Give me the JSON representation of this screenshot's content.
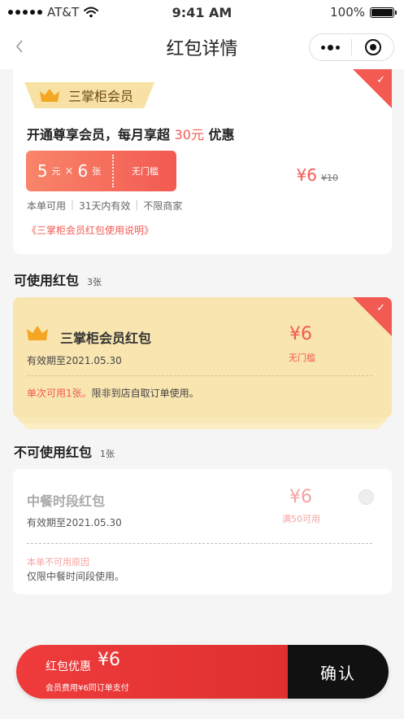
{
  "status_bar": {
    "carrier": "AT&T",
    "time": "9:41 AM",
    "battery": "100%"
  },
  "nav": {
    "title": "红包详情",
    "icons": [
      "back-arrow-icon",
      "more-icon",
      "close-ring-icon"
    ]
  },
  "member": {
    "tag": "三掌柜会员",
    "headline_prefix": "开通尊享会员，每月享超",
    "headline_amount": "30元",
    "headline_suffix": "优惠",
    "ticket": {
      "amount": "5",
      "amount_unit": "元",
      "times": "×",
      "count": "6",
      "count_unit": "张",
      "threshold": "无门槛"
    },
    "price": "¥6",
    "original_price": "¥10",
    "features": [
      "本单可用",
      "31天内有效",
      "不限商家"
    ],
    "link": "《三掌柜会员红包使用说明》",
    "selected": true
  },
  "usable": {
    "section_title": "可使用红包",
    "count": "3张",
    "coupon": {
      "name": "三掌柜会员红包",
      "expiry": "有效期至2021.05.30",
      "value": "¥6",
      "condition": "无门槛",
      "rule_highlight": "单次可用1张。",
      "rule_text": "限非到店自取订单使用。",
      "selected": true
    }
  },
  "unusable": {
    "section_title": "不可使用红包",
    "count": "1张",
    "coupon": {
      "name": "中餐时段红包",
      "expiry": "有效期至2021.05.30",
      "value": "¥6",
      "condition": "满50可用",
      "reason_title": "本单不可用原因",
      "reason": "仅限中餐时间段使用。"
    }
  },
  "bottom_bar": {
    "label": "红包优惠",
    "amount": "¥6",
    "sub": "会员费用¥6同订单支付",
    "confirm": "确认"
  },
  "colors": {
    "accent": "#f25a52",
    "gold": "#f8e5b0",
    "crown": "#f5a623",
    "confirm_bg": "#111111"
  }
}
